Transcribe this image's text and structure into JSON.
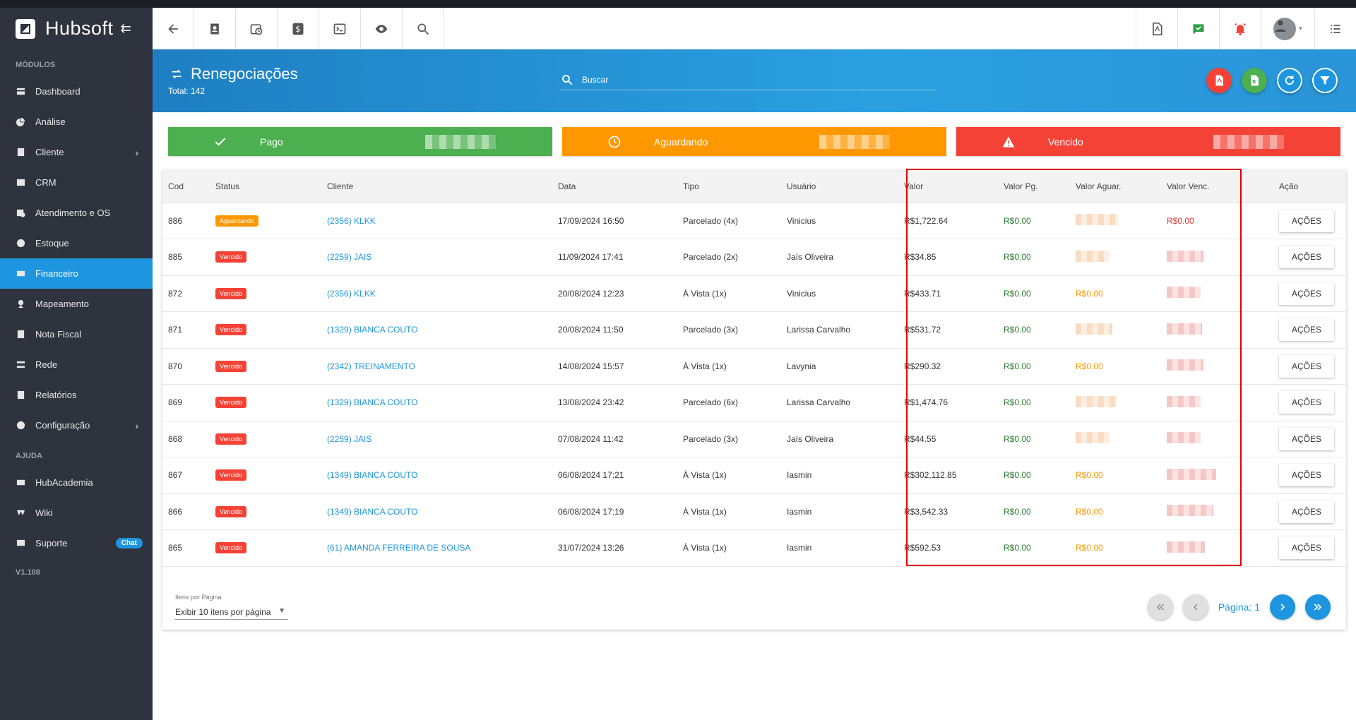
{
  "app": {
    "brand": "Hubsoft",
    "version": "V1.108"
  },
  "sidebar": {
    "section_modulos": "MÓDULOS",
    "section_ajuda": "AJUDA",
    "items": [
      {
        "label": "Dashboard",
        "icon": "dashboard-icon"
      },
      {
        "label": "Análise",
        "icon": "pie-chart-icon"
      },
      {
        "label": "Cliente",
        "icon": "contact-card-icon",
        "has_submenu": true
      },
      {
        "label": "CRM",
        "icon": "crm-icon"
      },
      {
        "label": "Atendimento e OS",
        "icon": "calendar-clock-icon"
      },
      {
        "label": "Estoque",
        "icon": "box-icon"
      },
      {
        "label": "Financeiro",
        "icon": "money-icon",
        "active": true
      },
      {
        "label": "Mapeamento",
        "icon": "map-pin-icon"
      },
      {
        "label": "Nota Fiscal",
        "icon": "document-icon"
      },
      {
        "label": "Rede",
        "icon": "network-icon"
      },
      {
        "label": "Relatórios",
        "icon": "report-icon"
      },
      {
        "label": "Configuração",
        "icon": "gear-icon",
        "has_submenu": true
      }
    ],
    "help_items": [
      {
        "label": "HubAcademia",
        "icon": "video-icon"
      },
      {
        "label": "Wiki",
        "icon": "wiki-icon"
      },
      {
        "label": "Suporte",
        "icon": "chat-icon",
        "badge": "Chat"
      }
    ]
  },
  "header": {
    "title": "Renegociações",
    "total": "Total: 142",
    "search_placeholder": "Buscar"
  },
  "cards": [
    {
      "label": "Pago",
      "color": "#4caf50",
      "icon": "check-icon"
    },
    {
      "label": "Aguardando",
      "color": "#ff9800",
      "icon": "clock-icon"
    },
    {
      "label": "Vencido",
      "color": "#f44336",
      "icon": "warning-icon"
    }
  ],
  "table": {
    "columns": [
      "Cod",
      "Status",
      "Cliente",
      "Data",
      "Tipo",
      "Usuário",
      "Valor",
      "Valor Pg.",
      "Valor Aguar.",
      "Valor Venc.",
      "Ação"
    ],
    "action_label": "AÇÕES",
    "rows": [
      {
        "cod": "886",
        "status": "Aguardando",
        "cliente": "(2356) KLKK",
        "data": "17/09/2024 16:50",
        "tipo": "Parcelado (4x)",
        "usuario": "Vinicius",
        "valor": "R$1,722.64",
        "valor_pg": "R$0.00",
        "valor_aguar": null,
        "valor_venc": "R$0.00"
      },
      {
        "cod": "885",
        "status": "Vencido",
        "cliente": "(2259) JAIS",
        "data": "11/09/2024 17:41",
        "tipo": "Parcelado (2x)",
        "usuario": "Jaís Oliveira",
        "valor": "R$34.85",
        "valor_pg": "R$0.00",
        "valor_aguar": null,
        "valor_venc": null
      },
      {
        "cod": "872",
        "status": "Vencido",
        "cliente": "(2356) KLKK",
        "data": "20/08/2024 12:23",
        "tipo": "À Vista (1x)",
        "usuario": "Vinicius",
        "valor": "R$433.71",
        "valor_pg": "R$0.00",
        "valor_aguar": "R$0.00",
        "valor_venc": null
      },
      {
        "cod": "871",
        "status": "Vencido",
        "cliente": "(1329) BIANCA COUTO",
        "data": "20/08/2024 11:50",
        "tipo": "Parcelado (3x)",
        "usuario": "Larissa Carvalho",
        "valor": "R$531.72",
        "valor_pg": "R$0.00",
        "valor_aguar": null,
        "valor_venc": null
      },
      {
        "cod": "870",
        "status": "Vencido",
        "cliente": "(2342) TREINAMENTO",
        "data": "14/08/2024 15:57",
        "tipo": "À Vista (1x)",
        "usuario": "Lavynia",
        "valor": "R$290.32",
        "valor_pg": "R$0.00",
        "valor_aguar": "R$0.00",
        "valor_venc": null
      },
      {
        "cod": "869",
        "status": "Vencido",
        "cliente": "(1329) BIANCA COUTO",
        "data": "13/08/2024 23:42",
        "tipo": "Parcelado (6x)",
        "usuario": "Larissa Carvalho",
        "valor": "R$1,474.76",
        "valor_pg": "R$0.00",
        "valor_aguar": null,
        "valor_venc": null
      },
      {
        "cod": "868",
        "status": "Vencido",
        "cliente": "(2259) JAIS",
        "data": "07/08/2024 11:42",
        "tipo": "Parcelado (3x)",
        "usuario": "Jaís Oliveira",
        "valor": "R$44.55",
        "valor_pg": "R$0.00",
        "valor_aguar": null,
        "valor_venc": null
      },
      {
        "cod": "867",
        "status": "Vencido",
        "cliente": "(1349) BIANCA COUTO",
        "data": "06/08/2024 17:21",
        "tipo": "À Vista (1x)",
        "usuario": "Iasmin",
        "valor": "R$302,112.85",
        "valor_pg": "R$0.00",
        "valor_aguar": "R$0.00",
        "valor_venc": null
      },
      {
        "cod": "866",
        "status": "Vencido",
        "cliente": "(1349) BIANCA COUTO",
        "data": "06/08/2024 17:19",
        "tipo": "À Vista (1x)",
        "usuario": "Iasmin",
        "valor": "R$3,542.33",
        "valor_pg": "R$0.00",
        "valor_aguar": "R$0.00",
        "valor_venc": null
      },
      {
        "cod": "865",
        "status": "Vencido",
        "cliente": "(61) AMANDA FERREIRA DE SOUSA",
        "data": "31/07/2024 13:26",
        "tipo": "À Vista (1x)",
        "usuario": "Iasmin",
        "valor": "R$592.53",
        "valor_pg": "R$0.00",
        "valor_aguar": "R$0.00",
        "valor_venc": null
      }
    ]
  },
  "pagination": {
    "per_page_label": "Itens por Página",
    "per_page_value": "Exibir 10 itens por página",
    "page_label": "Página: 1"
  }
}
